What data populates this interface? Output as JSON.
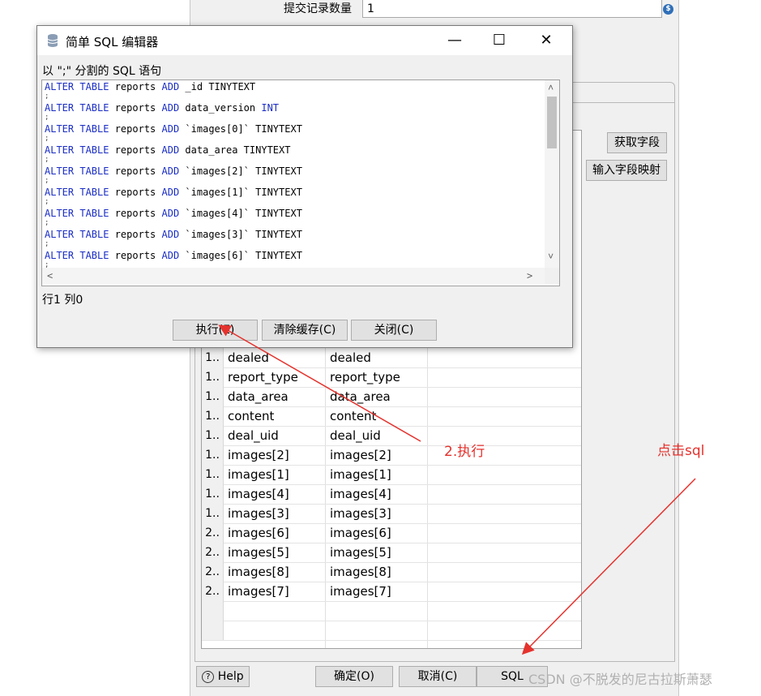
{
  "background": {
    "commit_label": "提交记录数量",
    "commit_value": "1",
    "get_fields_button": "获取字段",
    "input_mapping_button": "输入字段映射",
    "table_rows": [
      {
        "idx": "1..",
        "c1": "dealed",
        "c2": "dealed"
      },
      {
        "idx": "1..",
        "c1": "report_type",
        "c2": "report_type"
      },
      {
        "idx": "1..",
        "c1": "data_area",
        "c2": "data_area"
      },
      {
        "idx": "1..",
        "c1": "content",
        "c2": "content"
      },
      {
        "idx": "1..",
        "c1": "deal_uid",
        "c2": "deal_uid"
      },
      {
        "idx": "1..",
        "c1": "images[2]",
        "c2": "images[2]"
      },
      {
        "idx": "1..",
        "c1": "images[1]",
        "c2": "images[1]"
      },
      {
        "idx": "1..",
        "c1": "images[4]",
        "c2": "images[4]"
      },
      {
        "idx": "1..",
        "c1": "images[3]",
        "c2": "images[3]"
      },
      {
        "idx": "2..",
        "c1": "images[6]",
        "c2": "images[6]"
      },
      {
        "idx": "2..",
        "c1": "images[5]",
        "c2": "images[5]"
      },
      {
        "idx": "2..",
        "c1": "images[8]",
        "c2": "images[8]"
      },
      {
        "idx": "2..",
        "c1": "images[7]",
        "c2": "images[7]"
      }
    ],
    "help_button": "Help",
    "ok_button": "确定(O)",
    "cancel_button": "取消(C)",
    "sql_button": "SQL"
  },
  "dialog": {
    "title": "简单 SQL 编辑器",
    "sublabel": "以 \";\" 分割的 SQL 语句",
    "sql_lines": [
      {
        "prefix": "ALTER TABLE",
        "table": " reports ",
        "add": "ADD",
        "rest": " _id TINYTEXT",
        "type_kw": ""
      },
      {
        "prefix": "ALTER TABLE",
        "table": " reports ",
        "add": "ADD",
        "rest": " data_version ",
        "type_kw": "INT"
      },
      {
        "prefix": "ALTER TABLE",
        "table": " reports ",
        "add": "ADD",
        "rest": " `images[0]` TINYTEXT",
        "type_kw": ""
      },
      {
        "prefix": "ALTER TABLE",
        "table": " reports ",
        "add": "ADD",
        "rest": " data_area TINYTEXT",
        "type_kw": ""
      },
      {
        "prefix": "ALTER TABLE",
        "table": " reports ",
        "add": "ADD",
        "rest": " `images[2]` TINYTEXT",
        "type_kw": ""
      },
      {
        "prefix": "ALTER TABLE",
        "table": " reports ",
        "add": "ADD",
        "rest": " `images[1]` TINYTEXT",
        "type_kw": ""
      },
      {
        "prefix": "ALTER TABLE",
        "table": " reports ",
        "add": "ADD",
        "rest": " `images[4]` TINYTEXT",
        "type_kw": ""
      },
      {
        "prefix": "ALTER TABLE",
        "table": " reports ",
        "add": "ADD",
        "rest": " `images[3]` TINYTEXT",
        "type_kw": ""
      },
      {
        "prefix": "ALTER TABLE",
        "table": " reports ",
        "add": "ADD",
        "rest": " `images[6]` TINYTEXT",
        "type_kw": ""
      }
    ],
    "semicolon": ";",
    "position": "行1 列0",
    "execute_button": "执行(E)",
    "clear_cache_button": "清除缓存(C)",
    "close_button": "关闭(C)"
  },
  "annotations": {
    "step2": "2.执行",
    "click_sql": "点击sql"
  },
  "watermark": "CSDN @不脱发的尼古拉斯萧瑟",
  "colors": {
    "keyword": "#1b2ec4",
    "annotation": "#e5322d"
  }
}
